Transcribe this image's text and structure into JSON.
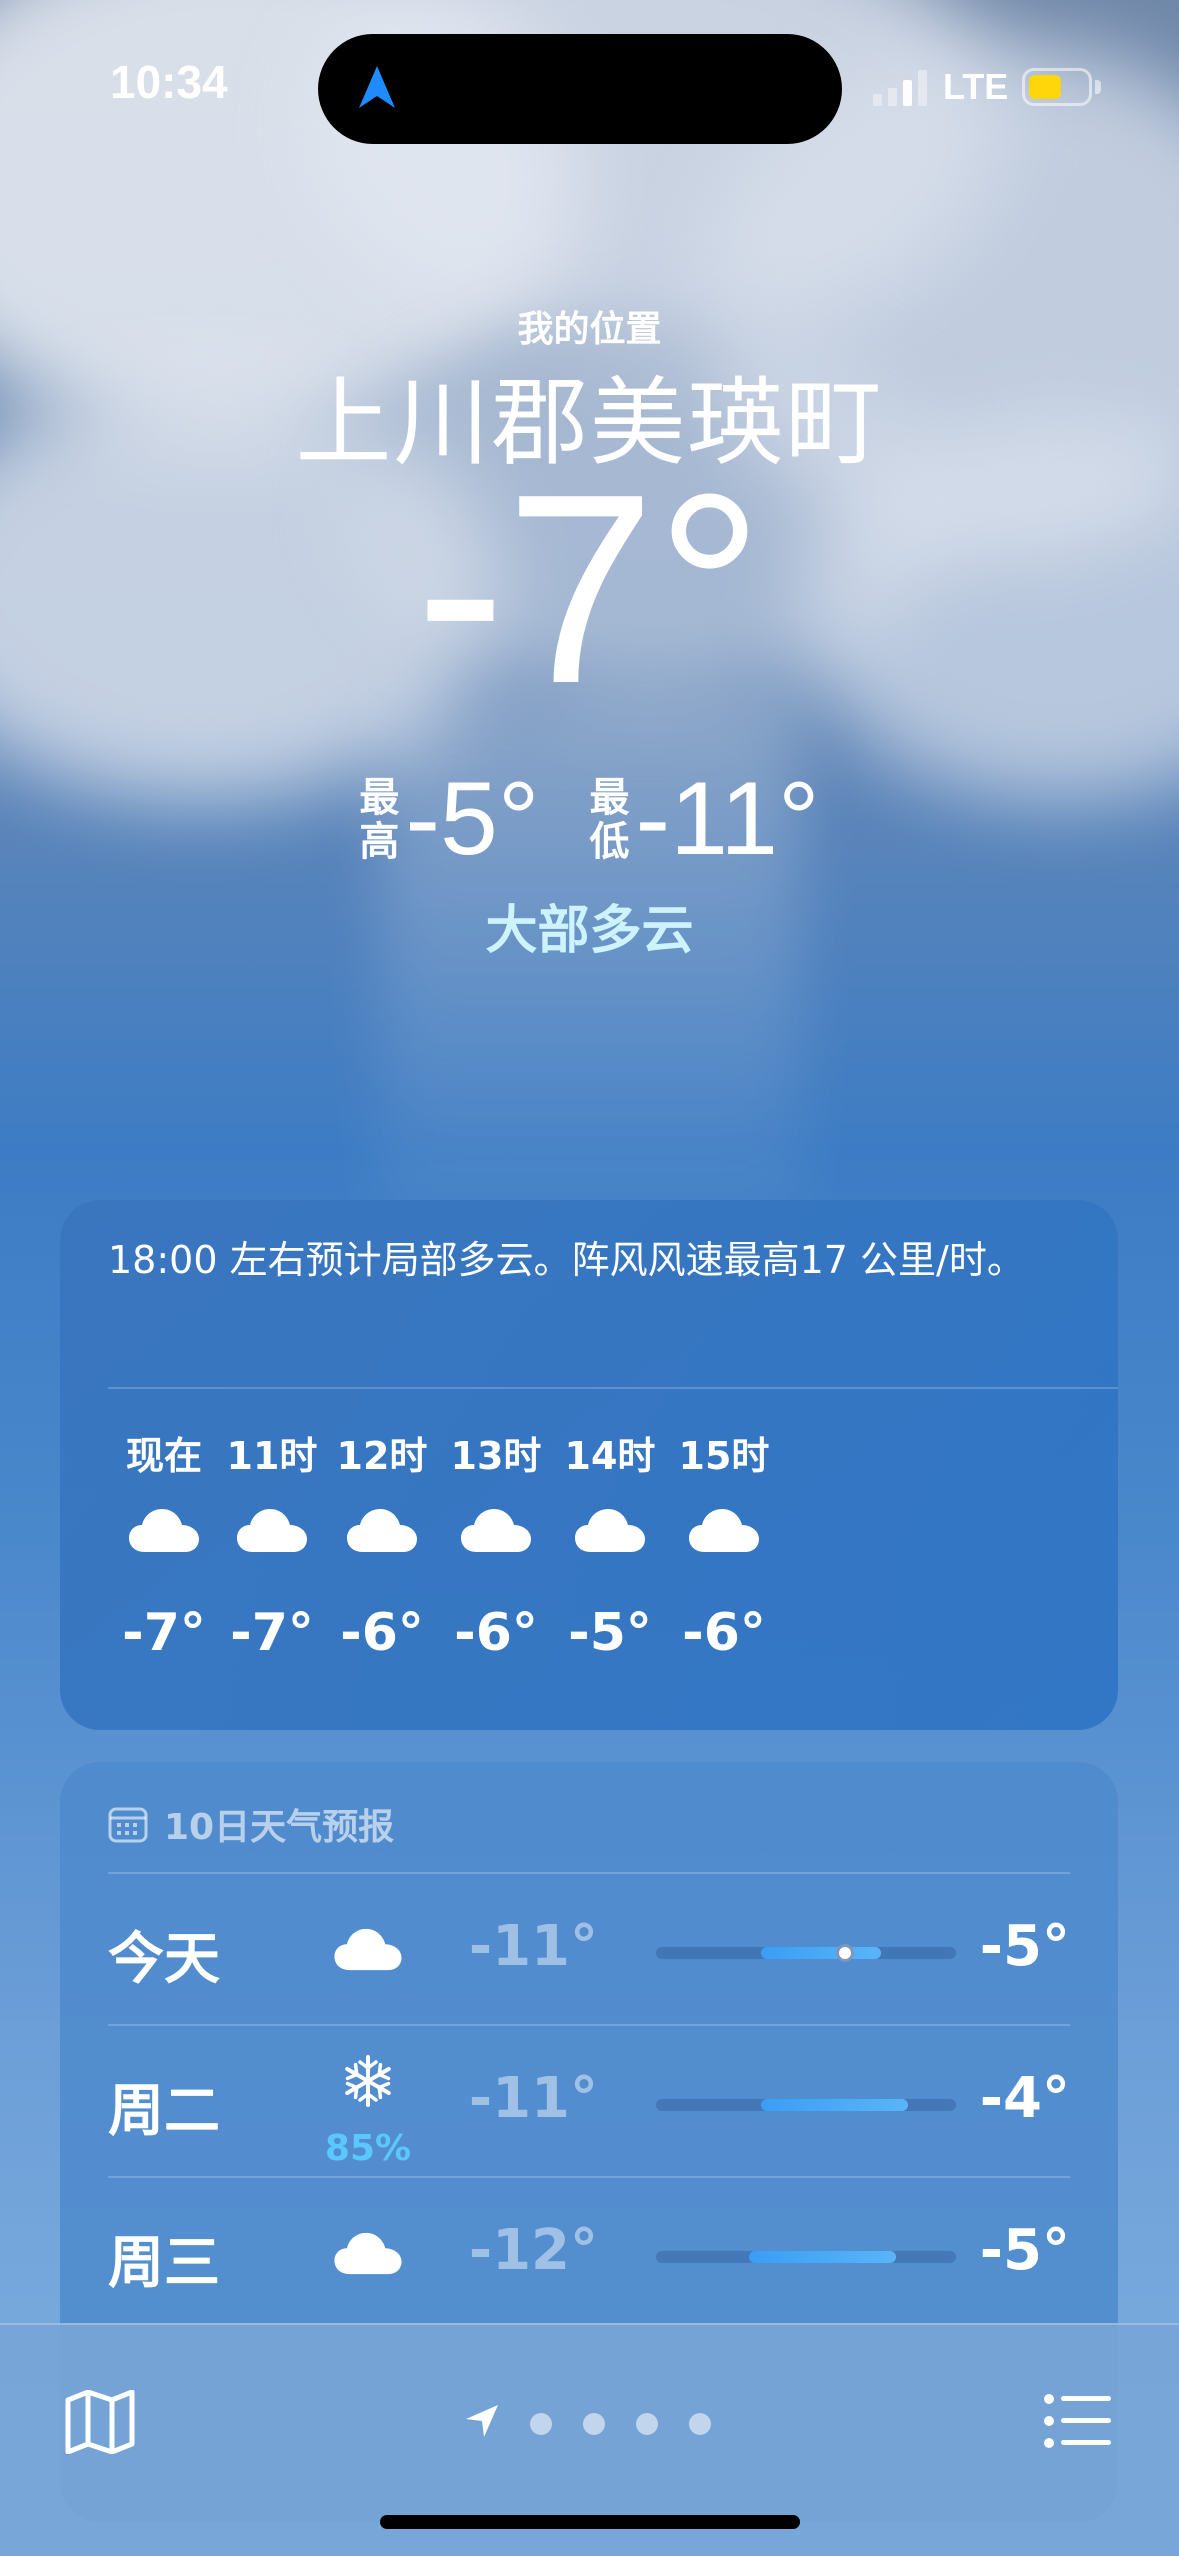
{
  "status_bar": {
    "time": "10:34",
    "network": "LTE",
    "battery_level": 0.58
  },
  "header": {
    "my_location": "我的位置",
    "city": "上川郡美瑛町",
    "temperature": "-7°",
    "high_label_1": "最",
    "high_label_2": "高",
    "high": "-5°",
    "low_label_1": "最",
    "low_label_2": "低",
    "low": "-11°",
    "condition": "大部多云"
  },
  "hourly": {
    "summary": "18:00 左右预计局部多云。阵风风速最高17 公里/时。",
    "hours": [
      {
        "label": "现在",
        "icon": "cloud-icon",
        "temp": "-7°"
      },
      {
        "label": "11时",
        "icon": "cloud-icon",
        "temp": "-7°"
      },
      {
        "label": "12时",
        "icon": "cloud-icon",
        "temp": "-6°"
      },
      {
        "label": "13时",
        "icon": "cloud-icon",
        "temp": "-6°"
      },
      {
        "label": "14时",
        "icon": "cloud-icon",
        "temp": "-5°"
      },
      {
        "label": "15时",
        "icon": "cloud-icon",
        "temp": "-6°"
      }
    ]
  },
  "daily": {
    "title": "10日天气预报",
    "days": [
      {
        "day": "今天",
        "icon": "cloud-icon",
        "precip": "",
        "low": "-11°",
        "high": "-5°",
        "range_start": 0.35,
        "range_end": 0.75,
        "current": 0.63
      },
      {
        "day": "周二",
        "icon": "snowflake-icon",
        "precip": "85%",
        "low": "-11°",
        "high": "-4°",
        "range_start": 0.35,
        "range_end": 0.84
      },
      {
        "day": "周三",
        "icon": "cloud-icon",
        "precip": "",
        "low": "-12°",
        "high": "-5°",
        "range_start": 0.31,
        "range_end": 0.8
      }
    ]
  },
  "toolbar": {
    "map": "map-icon",
    "list": "list-icon",
    "pages": 4
  }
}
